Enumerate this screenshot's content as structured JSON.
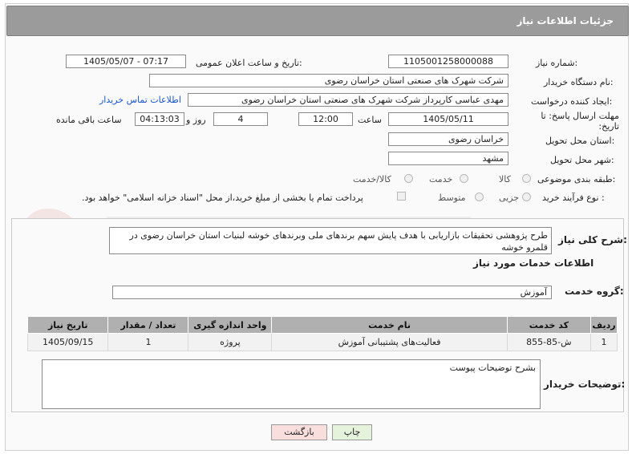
{
  "header": {
    "title": "جزئیات اطلاعات نیاز"
  },
  "fields": {
    "need_number_label": "شماره نیاز:",
    "need_number": "1105001258000088",
    "announce_label": "تاریخ و ساعت اعلان عمومی:",
    "announce_value": "1405/05/07 - 07:17",
    "buyer_org_label": "نام دستگاه خریدار:",
    "buyer_org": "شرکت شهرک های صنعتی استان خراسان رضوی",
    "requester_label": "ایجاد کننده درخواست:",
    "requester": "مهدی عباسی کارپرداز شرکت شهرک های صنعتی استان خراسان رضوی",
    "contact_link": "اطلاعات تماس خریدار",
    "deadline_label_1": "مهلت ارسال پاسخ: تا",
    "deadline_label_2": "تاریخ:",
    "deadline_date": "1405/05/11",
    "time_label": "ساعت",
    "deadline_time": "12:00",
    "days_value": "4",
    "days_label": "روز و",
    "remaining_time": "04:13:03",
    "remaining_label": "ساعت باقی مانده",
    "province_label": "استان محل تحویل:",
    "province": "خراسان رضوی",
    "city_label": "شهر محل تحویل:",
    "city": "مشهد",
    "category_label": "طبقه بندی موضوعی:",
    "category_options": [
      "کالا",
      "خدمت",
      "کالا/خدمت"
    ],
    "purchase_type_label": "نوع فرآیند خرید :",
    "purchase_options": [
      "جزیی",
      "متوسط"
    ],
    "payment_note": "پرداخت تمام یا بخشی از مبلغ خرید،از محل \"اسناد خزانه اسلامی\" خواهد بود."
  },
  "summary": {
    "label": "شرح کلی نیاز:",
    "text": "طرح پژوهشی تحقیقات بازاریابی با هدف پایش سهم برندهای ملی وبرندهای خوشه لبنیات استان خراسان رضوی در قلمرو خوشه"
  },
  "services": {
    "section_title": "اطلاعات خدمات مورد نیاز",
    "group_label": "گروه خدمت:",
    "group_value": "آموزش",
    "columns": [
      "ردیف",
      "کد خدمت",
      "نام خدمت",
      "واحد اندازه گیری",
      "تعداد / مقدار",
      "تاریخ نیاز"
    ],
    "rows": [
      {
        "row": "1",
        "code": "ش-85-855",
        "name": "فعالیت‌های پشتیبانی آموزش",
        "unit": "پروژه",
        "qty": "1",
        "date": "1405/09/15"
      }
    ]
  },
  "buyer_notes": {
    "label": "توضیحات خریدار:",
    "text": "بشرح توضیحات پیوست"
  },
  "buttons": {
    "print": "چاپ",
    "back": "بازگشت"
  },
  "colors": {
    "titlebar": "#9b9b9b",
    "link": "#1a55c8",
    "back_button": "#f9dede",
    "print_button": "#e6f3dc",
    "table_header": "#b0b0b0"
  }
}
